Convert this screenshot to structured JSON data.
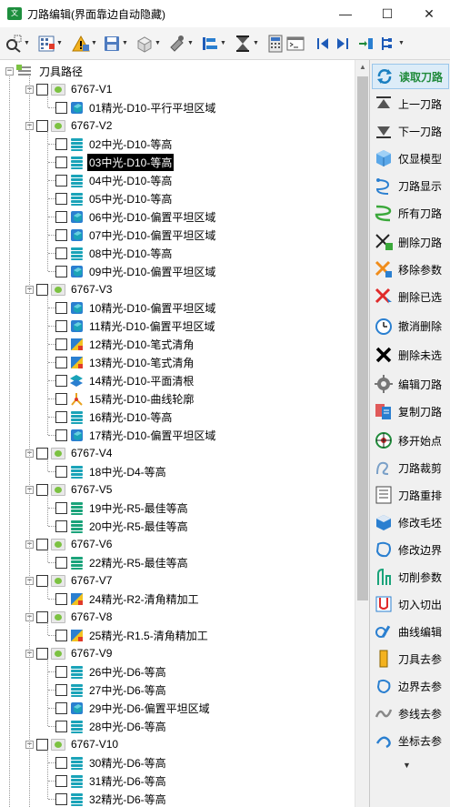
{
  "window": {
    "title": "刀路编辑(界面靠边自动隐藏)",
    "app_icon_text": "文",
    "minimize": "—",
    "maximize": "☐",
    "close": "✕"
  },
  "toolbar": {
    "buttons": [
      {
        "name": "zoom-select",
        "caret": true
      },
      {
        "name": "grid",
        "caret": true
      },
      {
        "name": "warning",
        "caret": true
      },
      {
        "name": "save",
        "caret": true
      },
      {
        "name": "box",
        "caret": true
      },
      {
        "name": "tool",
        "caret": true
      },
      {
        "name": "layers",
        "caret": true
      },
      {
        "name": "hourglass",
        "caret": true
      },
      {
        "name": "calculator",
        "caret": false
      },
      {
        "name": "terminal",
        "caret": false
      },
      {
        "name": "first",
        "caret": false
      },
      {
        "name": "last",
        "caret": false
      },
      {
        "name": "import",
        "caret": false
      },
      {
        "name": "branch",
        "caret": true
      }
    ]
  },
  "tree": {
    "root_label": "刀具路径",
    "groups": [
      {
        "label": "6767-V1",
        "ops": [
          {
            "label": "01精光-D10-平行平坦区域",
            "icon": "cube-blue"
          }
        ]
      },
      {
        "label": "6767-V2",
        "ops": [
          {
            "label": "02中光-D10-等高",
            "icon": "stack-teal"
          },
          {
            "label": "03中光-D10-等高",
            "icon": "stack-teal",
            "selected": true
          },
          {
            "label": "04中光-D10-等高",
            "icon": "stack-teal"
          },
          {
            "label": "05中光-D10-等高",
            "icon": "stack-teal"
          },
          {
            "label": "06中光-D10-偏置平坦区域",
            "icon": "cube-blue"
          },
          {
            "label": "07中光-D10-偏置平坦区域",
            "icon": "cube-blue"
          },
          {
            "label": "08中光-D10-等高",
            "icon": "stack-teal"
          },
          {
            "label": "09中光-D10-偏置平坦区域",
            "icon": "cube-blue"
          }
        ]
      },
      {
        "label": "6767-V3",
        "ops": [
          {
            "label": "10精光-D10-偏置平坦区域",
            "icon": "cube-blue"
          },
          {
            "label": "11精光-D10-偏置平坦区域",
            "icon": "cube-blue"
          },
          {
            "label": "12精光-D10-笔式清角",
            "icon": "corner-multi"
          },
          {
            "label": "13精光-D10-笔式清角",
            "icon": "corner-multi"
          },
          {
            "label": "14精光-D10-平面清根",
            "icon": "layers-teal"
          },
          {
            "label": "15精光-D10-曲线轮廓",
            "icon": "curve"
          },
          {
            "label": "16精光-D10-等高",
            "icon": "stack-teal"
          },
          {
            "label": "17精光-D10-偏置平坦区域",
            "icon": "cube-blue"
          }
        ]
      },
      {
        "label": "6767-V4",
        "ops": [
          {
            "label": "18中光-D4-等高",
            "icon": "stack-teal"
          }
        ]
      },
      {
        "label": "6767-V5",
        "ops": [
          {
            "label": "19中光-R5-最佳等高",
            "icon": "stack-green"
          },
          {
            "label": "20中光-R5-最佳等高",
            "icon": "stack-green"
          }
        ]
      },
      {
        "label": "6767-V6",
        "ops": [
          {
            "label": "22精光-R5-最佳等高",
            "icon": "stack-green"
          }
        ]
      },
      {
        "label": "6767-V7",
        "ops": [
          {
            "label": "24精光-R2-清角精加工",
            "icon": "corner-multi"
          }
        ]
      },
      {
        "label": "6767-V8",
        "ops": [
          {
            "label": "25精光-R1.5-清角精加工",
            "icon": "corner-multi"
          }
        ]
      },
      {
        "label": "6767-V9",
        "ops": [
          {
            "label": "26中光-D6-等高",
            "icon": "stack-teal"
          },
          {
            "label": "27中光-D6-等高",
            "icon": "stack-teal"
          },
          {
            "label": "29中光-D6-偏置平坦区域",
            "icon": "cube-blue"
          },
          {
            "label": "28中光-D6-等高",
            "icon": "stack-teal"
          }
        ]
      },
      {
        "label": "6767-V10",
        "ops": [
          {
            "label": "30精光-D6-等高",
            "icon": "stack-teal"
          },
          {
            "label": "31精光-D6-等高",
            "icon": "stack-teal"
          },
          {
            "label": "32精光-D6-等高",
            "icon": "stack-teal"
          }
        ]
      }
    ]
  },
  "commands": [
    {
      "label": "读取刀路",
      "icon": "refresh",
      "active": true
    },
    {
      "label": "上一刀路",
      "icon": "up-bar"
    },
    {
      "label": "下一刀路",
      "icon": "down-bar"
    },
    {
      "label": "仅显模型",
      "icon": "blue-cube"
    },
    {
      "label": "刀路显示",
      "icon": "toolpath-blue"
    },
    {
      "label": "所有刀路",
      "icon": "toolpath-green"
    },
    {
      "label": "删除刀路",
      "icon": "delete-green"
    },
    {
      "label": "移除参数",
      "icon": "delete-orange"
    },
    {
      "label": "删除已选",
      "icon": "delete-red"
    },
    {
      "label": "撤消删除",
      "icon": "undo-clock"
    },
    {
      "label": "删除未选",
      "icon": "x-black"
    },
    {
      "label": "编辑刀路",
      "icon": "gear"
    },
    {
      "label": "复制刀路",
      "icon": "copy"
    },
    {
      "label": "移开始点",
      "icon": "move-start"
    },
    {
      "label": "刀路裁剪",
      "icon": "trim"
    },
    {
      "label": "刀路重排",
      "icon": "reorder"
    },
    {
      "label": "修改毛坯",
      "icon": "stock"
    },
    {
      "label": "修改边界",
      "icon": "boundary"
    },
    {
      "label": "切削参数",
      "icon": "cut-params"
    },
    {
      "label": "切入切出",
      "icon": "lead-in"
    },
    {
      "label": "曲线编辑",
      "icon": "curve-edit"
    },
    {
      "label": "刀具去参",
      "icon": "tool-remove"
    },
    {
      "label": "边界去参",
      "icon": "boundary-remove"
    },
    {
      "label": "参线去参",
      "icon": "pattern-remove"
    },
    {
      "label": "坐标去参",
      "icon": "coord-remove"
    }
  ],
  "more_caret": "▼",
  "colors": {
    "active_cmd_text": "#1f8a3a",
    "selection_bg": "#000000",
    "teal": "#1aa3b8",
    "blue": "#2a7fd0"
  }
}
